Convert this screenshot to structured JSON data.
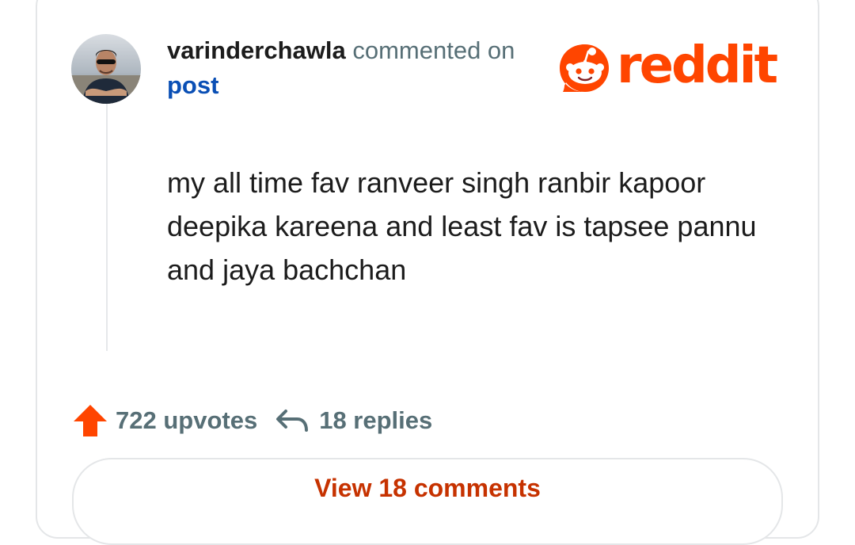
{
  "comment": {
    "username": "varinderchawla",
    "action_text": "commented on",
    "post_link": "post",
    "body": "my all time fav ranveer singh ranbir kapoor deepika kareena and least fav is tapsee pannu and jaya bachchan"
  },
  "brand": {
    "logo_text": "reddit",
    "logo_icon": "reddit-snoo-icon",
    "color": "#ff4500"
  },
  "footer": {
    "upvote_icon": "upvote-arrow-icon",
    "upvote_color": "#ff4500",
    "upvotes_label": "722 upvotes",
    "reply_icon": "reply-arrow-icon",
    "replies_label": "18 replies"
  },
  "view_comments_button": {
    "label": "View 18 comments",
    "color": "#c63200"
  }
}
